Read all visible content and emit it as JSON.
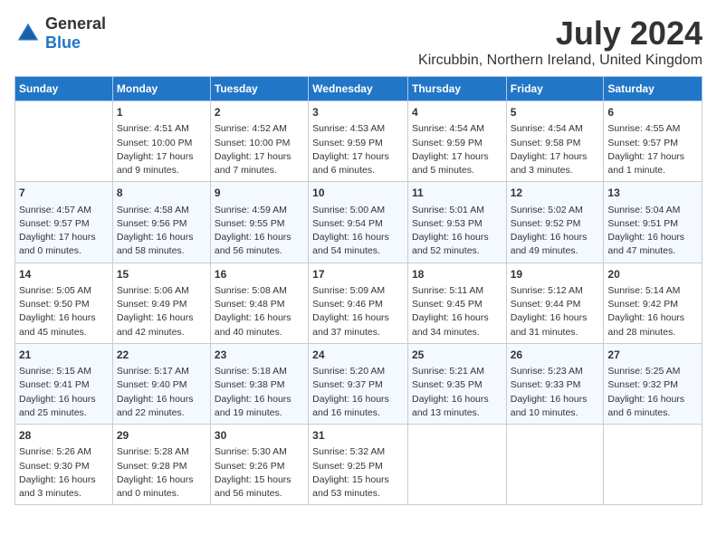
{
  "header": {
    "logo_general": "General",
    "logo_blue": "Blue",
    "month_title": "July 2024",
    "location": "Kircubbin, Northern Ireland, United Kingdom"
  },
  "days_of_week": [
    "Sunday",
    "Monday",
    "Tuesday",
    "Wednesday",
    "Thursday",
    "Friday",
    "Saturday"
  ],
  "weeks": [
    [
      {
        "day": "",
        "data": ""
      },
      {
        "day": "1",
        "data": "Sunrise: 4:51 AM\nSunset: 10:00 PM\nDaylight: 17 hours\nand 9 minutes."
      },
      {
        "day": "2",
        "data": "Sunrise: 4:52 AM\nSunset: 10:00 PM\nDaylight: 17 hours\nand 7 minutes."
      },
      {
        "day": "3",
        "data": "Sunrise: 4:53 AM\nSunset: 9:59 PM\nDaylight: 17 hours\nand 6 minutes."
      },
      {
        "day": "4",
        "data": "Sunrise: 4:54 AM\nSunset: 9:59 PM\nDaylight: 17 hours\nand 5 minutes."
      },
      {
        "day": "5",
        "data": "Sunrise: 4:54 AM\nSunset: 9:58 PM\nDaylight: 17 hours\nand 3 minutes."
      },
      {
        "day": "6",
        "data": "Sunrise: 4:55 AM\nSunset: 9:57 PM\nDaylight: 17 hours\nand 1 minute."
      }
    ],
    [
      {
        "day": "7",
        "data": "Sunrise: 4:57 AM\nSunset: 9:57 PM\nDaylight: 17 hours\nand 0 minutes."
      },
      {
        "day": "8",
        "data": "Sunrise: 4:58 AM\nSunset: 9:56 PM\nDaylight: 16 hours\nand 58 minutes."
      },
      {
        "day": "9",
        "data": "Sunrise: 4:59 AM\nSunset: 9:55 PM\nDaylight: 16 hours\nand 56 minutes."
      },
      {
        "day": "10",
        "data": "Sunrise: 5:00 AM\nSunset: 9:54 PM\nDaylight: 16 hours\nand 54 minutes."
      },
      {
        "day": "11",
        "data": "Sunrise: 5:01 AM\nSunset: 9:53 PM\nDaylight: 16 hours\nand 52 minutes."
      },
      {
        "day": "12",
        "data": "Sunrise: 5:02 AM\nSunset: 9:52 PM\nDaylight: 16 hours\nand 49 minutes."
      },
      {
        "day": "13",
        "data": "Sunrise: 5:04 AM\nSunset: 9:51 PM\nDaylight: 16 hours\nand 47 minutes."
      }
    ],
    [
      {
        "day": "14",
        "data": "Sunrise: 5:05 AM\nSunset: 9:50 PM\nDaylight: 16 hours\nand 45 minutes."
      },
      {
        "day": "15",
        "data": "Sunrise: 5:06 AM\nSunset: 9:49 PM\nDaylight: 16 hours\nand 42 minutes."
      },
      {
        "day": "16",
        "data": "Sunrise: 5:08 AM\nSunset: 9:48 PM\nDaylight: 16 hours\nand 40 minutes."
      },
      {
        "day": "17",
        "data": "Sunrise: 5:09 AM\nSunset: 9:46 PM\nDaylight: 16 hours\nand 37 minutes."
      },
      {
        "day": "18",
        "data": "Sunrise: 5:11 AM\nSunset: 9:45 PM\nDaylight: 16 hours\nand 34 minutes."
      },
      {
        "day": "19",
        "data": "Sunrise: 5:12 AM\nSunset: 9:44 PM\nDaylight: 16 hours\nand 31 minutes."
      },
      {
        "day": "20",
        "data": "Sunrise: 5:14 AM\nSunset: 9:42 PM\nDaylight: 16 hours\nand 28 minutes."
      }
    ],
    [
      {
        "day": "21",
        "data": "Sunrise: 5:15 AM\nSunset: 9:41 PM\nDaylight: 16 hours\nand 25 minutes."
      },
      {
        "day": "22",
        "data": "Sunrise: 5:17 AM\nSunset: 9:40 PM\nDaylight: 16 hours\nand 22 minutes."
      },
      {
        "day": "23",
        "data": "Sunrise: 5:18 AM\nSunset: 9:38 PM\nDaylight: 16 hours\nand 19 minutes."
      },
      {
        "day": "24",
        "data": "Sunrise: 5:20 AM\nSunset: 9:37 PM\nDaylight: 16 hours\nand 16 minutes."
      },
      {
        "day": "25",
        "data": "Sunrise: 5:21 AM\nSunset: 9:35 PM\nDaylight: 16 hours\nand 13 minutes."
      },
      {
        "day": "26",
        "data": "Sunrise: 5:23 AM\nSunset: 9:33 PM\nDaylight: 16 hours\nand 10 minutes."
      },
      {
        "day": "27",
        "data": "Sunrise: 5:25 AM\nSunset: 9:32 PM\nDaylight: 16 hours\nand 6 minutes."
      }
    ],
    [
      {
        "day": "28",
        "data": "Sunrise: 5:26 AM\nSunset: 9:30 PM\nDaylight: 16 hours\nand 3 minutes."
      },
      {
        "day": "29",
        "data": "Sunrise: 5:28 AM\nSunset: 9:28 PM\nDaylight: 16 hours\nand 0 minutes."
      },
      {
        "day": "30",
        "data": "Sunrise: 5:30 AM\nSunset: 9:26 PM\nDaylight: 15 hours\nand 56 minutes."
      },
      {
        "day": "31",
        "data": "Sunrise: 5:32 AM\nSunset: 9:25 PM\nDaylight: 15 hours\nand 53 minutes."
      },
      {
        "day": "",
        "data": ""
      },
      {
        "day": "",
        "data": ""
      },
      {
        "day": "",
        "data": ""
      }
    ]
  ]
}
